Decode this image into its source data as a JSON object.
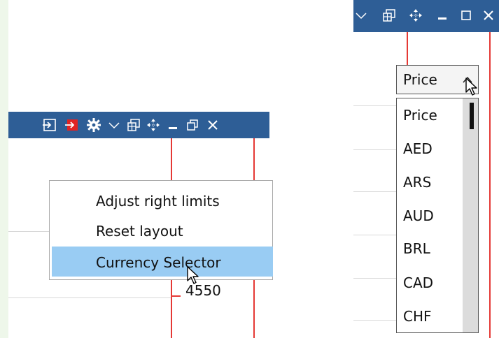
{
  "left_panel": {
    "context_menu": {
      "items": [
        {
          "label": "Adjust right limits"
        },
        {
          "label": "Reset layout"
        },
        {
          "label": "Currency Selector",
          "highlighted": true
        }
      ]
    },
    "axis_label": "4550"
  },
  "right_panel": {
    "currency_dropdown": {
      "selected": "Price",
      "options": [
        "Price",
        "AED",
        "ARS",
        "AUD",
        "BRL",
        "CAD",
        "CHF"
      ]
    }
  },
  "icons": [
    "import-icon",
    "import-red-icon",
    "gear-icon",
    "chevron-down-icon",
    "windows-icon",
    "move-icon",
    "minimize-icon",
    "restore-icon",
    "close-icon",
    "maximize-icon",
    "mouse-cursor-icon"
  ],
  "colors": {
    "toolbar": "#2e5e96",
    "menu_highlight": "#99ccf3",
    "grid_line": "#e53935",
    "strip": "#eef7ea"
  }
}
